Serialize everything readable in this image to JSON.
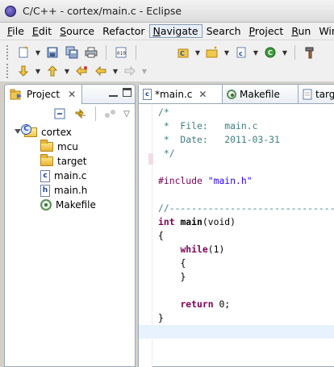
{
  "window": {
    "title": "C/C++ - cortex/main.c - Eclipse"
  },
  "menu": [
    {
      "label": "File",
      "mnemonic": "F",
      "rest": "ile"
    },
    {
      "label": "Edit",
      "mnemonic": "E",
      "rest": "dit"
    },
    {
      "label": "Source",
      "mnemonic": "S",
      "rest": "ource"
    },
    {
      "label": "Refactor",
      "mnemonic": "",
      "rest": "Refactor"
    },
    {
      "label": "Navigate",
      "mnemonic": "N",
      "rest": "avigate"
    },
    {
      "label": "Search",
      "mnemonic": "",
      "rest": "Search"
    },
    {
      "label": "Project",
      "mnemonic": "P",
      "rest": "roject"
    },
    {
      "label": "Run",
      "mnemonic": "R",
      "rest": "un"
    },
    {
      "label": "Window",
      "mnemonic": "",
      "rest": "Windo"
    }
  ],
  "project_view": {
    "tab_label": "Project",
    "tree": [
      {
        "label": "cortex",
        "type": "project"
      },
      {
        "label": "mcu",
        "type": "folder"
      },
      {
        "label": "target",
        "type": "folder"
      },
      {
        "label": "main.c",
        "type": "c-file",
        "glyph": "c"
      },
      {
        "label": "main.h",
        "type": "h-file",
        "glyph": "h"
      },
      {
        "label": "Makefile",
        "type": "makefile"
      }
    ]
  },
  "editor": {
    "tabs": [
      {
        "label": "*main.c",
        "glyph": "c",
        "active": true
      },
      {
        "label": "Makefile",
        "active": false
      },
      {
        "label": "targ",
        "active": false
      }
    ],
    "code": {
      "l1": "/*",
      "l2": " *  File:   main.c",
      "l3": " *  Date:   2011-03-31",
      "l4": " */",
      "l6_directive": "#include ",
      "l6_string": "\"main.h\"",
      "l8": "//--------------------------------",
      "l9_kw": "int",
      "l9_fn": "main",
      "l9_rest": "(void)",
      "l10": "{",
      "l11_kw": "while",
      "l11_rest": "(1)",
      "l12": "{",
      "l13": "}",
      "l15_kw": "return",
      "l15_rest": " 0;",
      "l16": "}"
    }
  }
}
